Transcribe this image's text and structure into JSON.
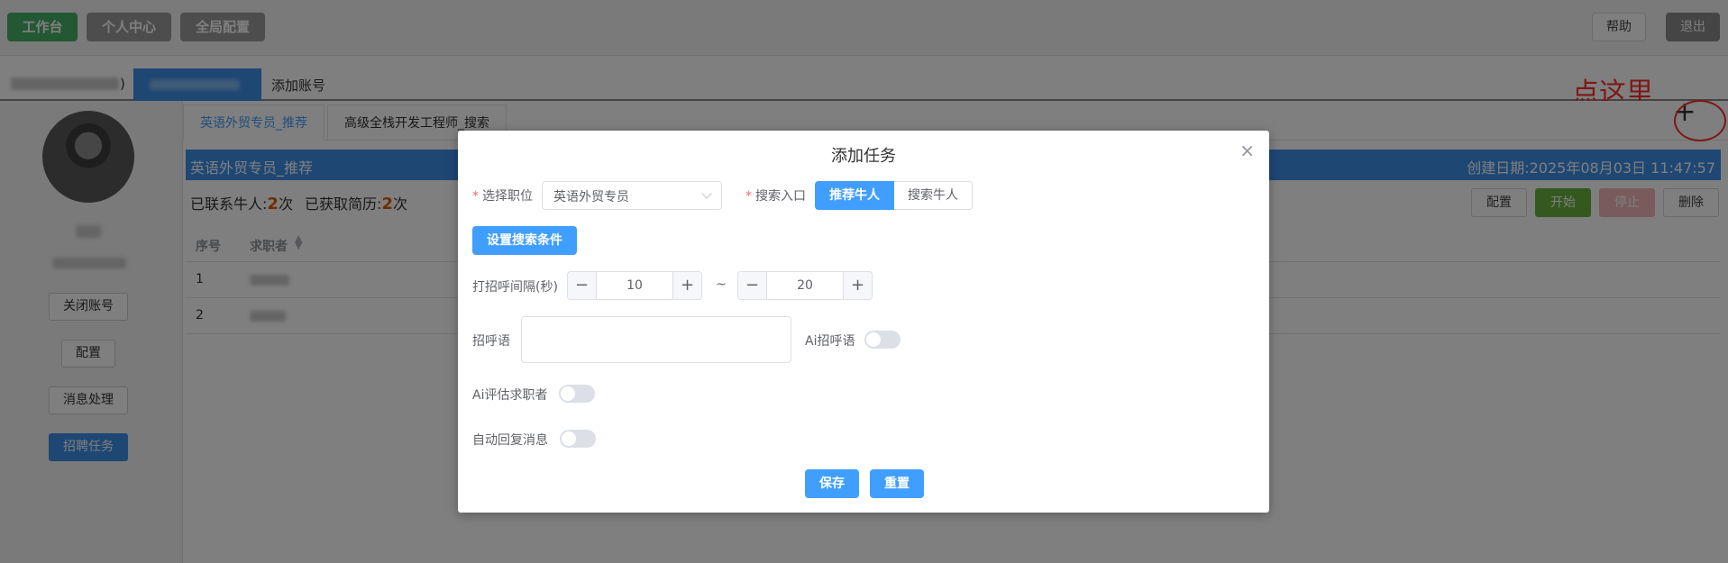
{
  "topbar": {
    "workbench": "工作台",
    "personal_center": "个人中心",
    "global_config": "全局配置",
    "help": "帮助",
    "logout": "退出"
  },
  "account_bar": {
    "paren": ")",
    "add_account": "添加账号"
  },
  "hint": {
    "text": "点这里",
    "plus": "+"
  },
  "sidebar": {
    "close_account": "关闭账号",
    "config": "配置",
    "message_handling": "消息处理",
    "recruit_task": "招聘任务"
  },
  "tabs": [
    {
      "label": "英语外贸专员_推荐"
    },
    {
      "label": "高级全栈开发工程师_搜索"
    }
  ],
  "task_panel": {
    "title": "英语外贸专员_推荐",
    "created": "创建日期:2025年08月03日 11:47:57",
    "contacted_label": "已联系牛人:",
    "contacted_count": "2",
    "resume_label": "已获取简历:",
    "resume_count": "2",
    "times_unit": "次",
    "buttons": {
      "config": "配置",
      "start": "开始",
      "stop": "停止",
      "delete": "删除"
    }
  },
  "table": {
    "headers": [
      "序号",
      "求职者"
    ],
    "rows": [
      {
        "index": "1"
      },
      {
        "index": "2"
      }
    ]
  },
  "dialog": {
    "title": "添加任务",
    "close": "×",
    "position_label": "选择职位",
    "position_value": "英语外贸专员",
    "search_entry_label": "搜索入口",
    "seg_recommend": "推荐牛人",
    "seg_search": "搜索牛人",
    "set_conditions": "设置搜索条件",
    "interval_label": "打招呼间隔(秒)",
    "interval_min": "10",
    "interval_max": "20",
    "tilde": "~",
    "minus": "−",
    "plus": "+",
    "greeting_label": "招呼语",
    "greeting_value": "",
    "ai_greeting_label": "Ai招呼语",
    "ai_eval_label": "Ai评估求职者",
    "auto_reply_label": "自动回复消息",
    "save": "保存",
    "reset": "重置"
  },
  "colors": {
    "accent": "#409eff",
    "band": "#3d8ee8",
    "green": "#47b06a",
    "hint_red": "#ff2d2d"
  }
}
